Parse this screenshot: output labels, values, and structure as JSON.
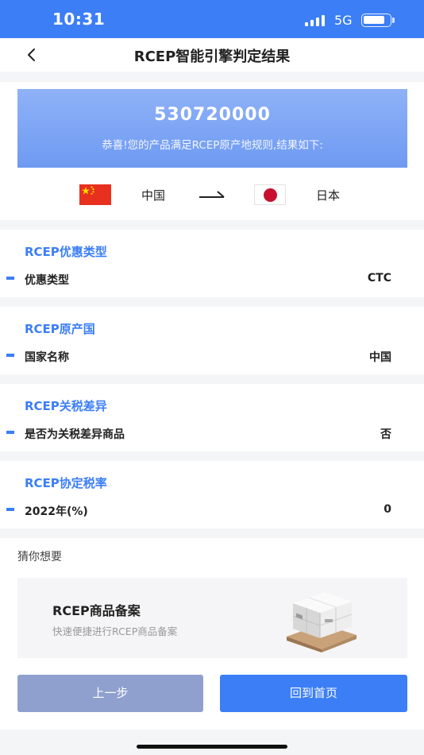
{
  "status_bar": {
    "time": "10:31",
    "network": "5G"
  },
  "nav": {
    "title": "RCEP智能引擎判定结果"
  },
  "result": {
    "code": "530720000",
    "message": "恭喜!您的产品满足RCEP原产地规则,结果如下:",
    "origin_country": "中国",
    "destination_country": "日本"
  },
  "sections": [
    {
      "title": "RCEP优惠类型",
      "label": "优惠类型",
      "value": "CTC"
    },
    {
      "title": "RCEP原产国",
      "label": "国家名称",
      "value": "中国"
    },
    {
      "title": "RCEP关税差异",
      "label": "是否为关税差异商品",
      "value": "否"
    },
    {
      "title": "RCEP协定税率",
      "label": "2022年(%)",
      "value": "0"
    }
  ],
  "guess": {
    "title": "猜你想要",
    "card_title": "RCEP商品备案",
    "card_subtitle": "快速便捷进行RCEP商品备案"
  },
  "buttons": {
    "prev": "上一步",
    "home": "回到首页"
  },
  "colors": {
    "accent": "#3b7ef6",
    "disabled_button": "#8fa0cf"
  }
}
